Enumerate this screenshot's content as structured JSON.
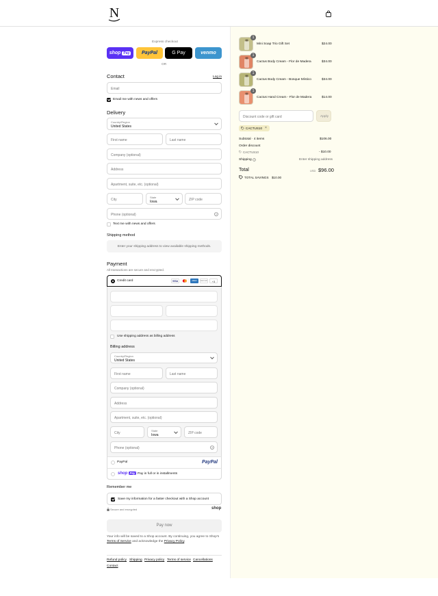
{
  "header": {
    "logo_letter": "N",
    "bag_icon": "shopping-bag-icon"
  },
  "express": {
    "title": "Express checkout",
    "shop_pay": "shop",
    "shop_pay_tag": "Pay",
    "paypal": "PayPal",
    "gpay": "G Pay",
    "venmo": "venmo",
    "or": "OR"
  },
  "contact": {
    "title": "Contact",
    "login": "Log in",
    "email_placeholder": "Email",
    "news_label": "Email me with news and offers"
  },
  "delivery": {
    "title": "Delivery",
    "country_label": "Country/Region",
    "country_value": "United States",
    "first_name": "First name",
    "last_name": "Last name",
    "company": "Company (optional)",
    "address": "Address",
    "apartment": "Apartment, suite, etc. (optional)",
    "city": "City",
    "state_label": "State",
    "state_value": "Iowa",
    "zip": "ZIP code",
    "phone": "Phone (optional)",
    "text_label": "Text me with news and offers"
  },
  "shipping": {
    "title": "Shipping method",
    "message": "Enter your shipping address to view available shipping methods."
  },
  "payment": {
    "title": "Payment",
    "subtitle": "All transactions are secure and encrypted.",
    "credit_card": "Credit card",
    "cards": [
      "VISA",
      "MC",
      "AMEX",
      "DISCOVER"
    ],
    "more_cards": "+3",
    "same_address": "Use shipping address as billing address",
    "billing_title": "Billing address",
    "paypal_option": "PayPal",
    "paypal_logo": "PayPal",
    "shoppay_option": "Pay in full or in installments"
  },
  "billing": {
    "country_label": "Country/Region",
    "country_value": "United States",
    "first_name": "First name",
    "last_name": "Last name",
    "company": "Company (optional)",
    "address": "Address",
    "apartment": "Apartment, suite, etc. (optional)",
    "city": "City",
    "state_label": "State",
    "state_value": "Iowa",
    "zip": "ZIP code",
    "phone": "Phone (optional)"
  },
  "remember": {
    "title": "Remember me",
    "save_label": "Save my information for a faster checkout with a Shop account",
    "secure": "Secure and encrypted",
    "shop_logo": "shop"
  },
  "pay_now": "Pay now",
  "legal": {
    "line1": "Your info will be saved to a Shop account. By continuing, you agree to Shop's",
    "terms": "Terms of Service",
    "and": "and acknowledge the",
    "privacy": "Privacy Policy",
    "dot": "."
  },
  "footer_links": [
    "Refund policy",
    "Shipping",
    "Privacy policy",
    "Terms of service",
    "Cancellations",
    "Contact"
  ],
  "cart": {
    "items": [
      {
        "name": "Mini Soap Trio Gift Set",
        "price": "$24.00",
        "qty": "1",
        "color": "#c3bf8a"
      },
      {
        "name": "Cactus Body Cream - Flor de Madera",
        "price": "$34.00",
        "qty": "1",
        "color": "#e08565"
      },
      {
        "name": "Cactus Body Cream - Bosque Místico",
        "price": "$34.00",
        "qty": "1",
        "color": "#b7b576"
      },
      {
        "name": "Cactus Hand Cream - Flor de Madera",
        "price": "$14.00",
        "qty": "1",
        "color": "#e8906f"
      }
    ],
    "discount_placeholder": "Discount code or gift card",
    "apply": "Apply",
    "code": "CACTUS10",
    "subtotal_label": "Subtotal · 4 items",
    "subtotal": "$106.00",
    "order_discount": "Order discount",
    "discount_code": "CACTUS10",
    "discount_value": "- $10.00",
    "shipping_label": "Shipping",
    "shipping_value": "Enter shipping address",
    "total_label": "Total",
    "currency": "USD",
    "total": "$96.00",
    "savings": "TOTAL SAVINGS",
    "savings_value": "$10.00"
  }
}
